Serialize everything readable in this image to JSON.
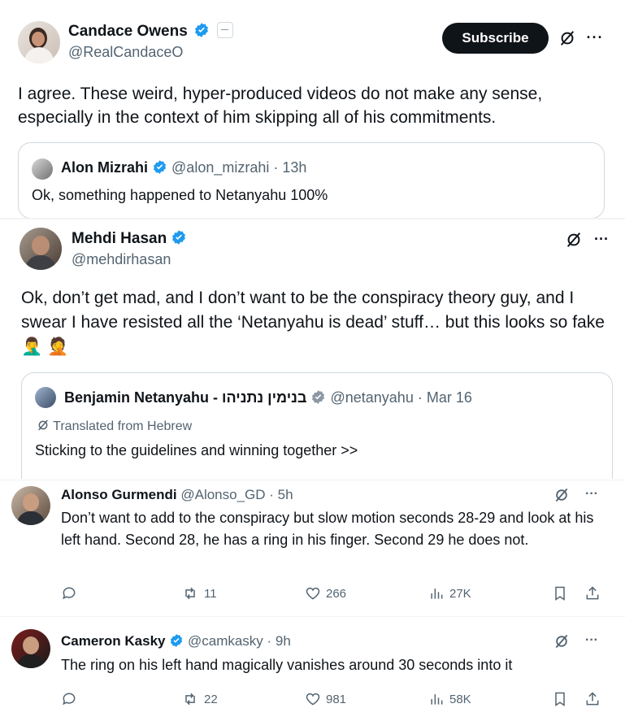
{
  "main_post": {
    "name": "Candace Owens",
    "handle": "@RealCandaceO",
    "subscribe_label": "Subscribe",
    "text": "I agree. These weird, hyper-produced videos do not make any sense, especially in the context of him skipping all of his commitments."
  },
  "quoted_post": {
    "name": "Alon Mizrahi",
    "handle_time": "@alon_mizrahi · 13h",
    "text": "Ok, something happened to Netanyahu 100%"
  },
  "second_post": {
    "name": "Mehdi Hasan",
    "handle": "@mehdirhasan",
    "text": "Ok, don’t get mad, and I don’t want to be the conspiracy theory guy, and I swear I have resisted all the ‘Netanyahu is dead’ stuff… but this looks so fake",
    "emoji": "🤦‍♂️ 🤦"
  },
  "second_quoted": {
    "name": "Benjamin Netanyahu - בנימין נתניהו",
    "handle_time": "@netanyahu · Mar 16",
    "translated_label": "Translated from Hebrew",
    "text": "Sticking to the guidelines and winning together >>"
  },
  "reply1": {
    "name": "Alonso Gurmendi",
    "handle_time": "@Alonso_GD · 5h",
    "text": "Don’t want to add to the conspiracy but slow motion seconds 28-29 and look at his left hand. Second 28, he has a ring in his finger. Second 29 he does not.",
    "retweets": "11",
    "likes": "266",
    "views": "27K"
  },
  "reply2": {
    "name": "Cameron Kasky",
    "handle_time": "@camkasky · 9h",
    "text": "The ring on his left hand magically vanishes around 30 seconds into it",
    "retweets": "22",
    "likes": "981",
    "views": "58K"
  },
  "colors": {
    "verified": "#1d9bf0",
    "text": "#0f1419",
    "muted": "#536471",
    "border": "#cfd9de"
  }
}
